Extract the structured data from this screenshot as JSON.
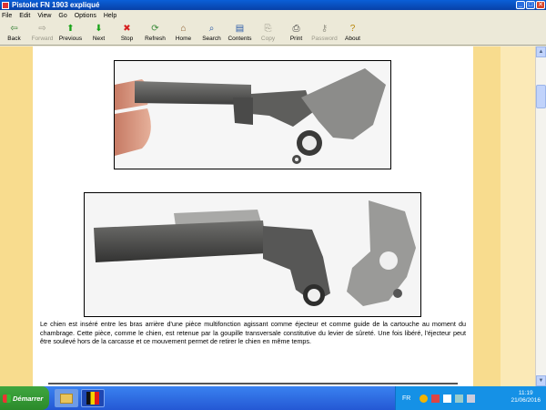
{
  "window": {
    "title": "Pistolet FN 1903 expliqué",
    "buttons": {
      "minimize": "_",
      "maximize": "□",
      "close": "✕"
    }
  },
  "menu": [
    "File",
    "Edit",
    "View",
    "Go",
    "Options",
    "Help"
  ],
  "toolbar": [
    {
      "label": "Back",
      "icon": "back-arrow-icon",
      "glyph": "⇦",
      "color": "#2f7d2f",
      "enabled": true
    },
    {
      "label": "Forward",
      "icon": "forward-arrow-icon",
      "glyph": "⇨",
      "color": "#9a988a",
      "enabled": false
    },
    {
      "label": "Previous",
      "icon": "up-arrow-icon",
      "glyph": "⬆",
      "color": "#19a319",
      "enabled": true
    },
    {
      "label": "Next",
      "icon": "down-arrow-icon",
      "glyph": "⬇",
      "color": "#19a319",
      "enabled": true
    },
    {
      "label": "Stop",
      "icon": "stop-icon",
      "glyph": "✖",
      "color": "#d62020",
      "enabled": true
    },
    {
      "label": "Refresh",
      "icon": "refresh-icon",
      "glyph": "⟳",
      "color": "#3a8a3a",
      "enabled": true
    },
    {
      "label": "Home",
      "icon": "home-icon",
      "glyph": "⌂",
      "color": "#8a5a2a",
      "enabled": true
    },
    {
      "label": "Search",
      "icon": "search-icon",
      "glyph": "⌕",
      "color": "#2a5aa8",
      "enabled": true
    },
    {
      "label": "Contents",
      "icon": "contents-icon",
      "glyph": "▤",
      "color": "#2a5aa8",
      "enabled": true
    },
    {
      "label": "Copy",
      "icon": "copy-icon",
      "glyph": "⎘",
      "color": "#9a988a",
      "enabled": false
    },
    {
      "label": "Print",
      "icon": "print-icon",
      "glyph": "⎙",
      "color": "#444444",
      "enabled": true
    },
    {
      "label": "Password",
      "icon": "key-icon",
      "glyph": "⚷",
      "color": "#9a988a",
      "enabled": false
    },
    {
      "label": "About",
      "icon": "about-icon",
      "glyph": "?",
      "color": "#b8860b",
      "enabled": true
    }
  ],
  "content": {
    "paragraph": "Le chien est inséré entre les bras arrière d'une pièce multifonction agissant comme éjecteur et comme guide de la cartouche au moment du chambrage. Cette pièce, comme le chien, est retenue par la goupille transversale constitutive du levier de sûreté. Une fois libéré, l'éjecteur peut être soulevé hors de la carcasse et ce mouvement permet de retirer le chien en même temps."
  },
  "taskbar": {
    "start_label": "Démarrer",
    "language": "FR",
    "time": "11:19",
    "date": "21/06/2016"
  }
}
